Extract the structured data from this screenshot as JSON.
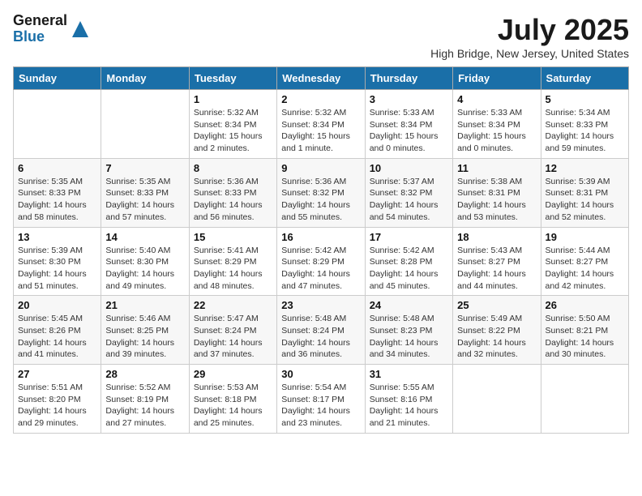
{
  "logo": {
    "general": "General",
    "blue": "Blue"
  },
  "title": "July 2025",
  "subtitle": "High Bridge, New Jersey, United States",
  "days_header": [
    "Sunday",
    "Monday",
    "Tuesday",
    "Wednesday",
    "Thursday",
    "Friday",
    "Saturday"
  ],
  "weeks": [
    [
      {
        "day": "",
        "info": ""
      },
      {
        "day": "",
        "info": ""
      },
      {
        "day": "1",
        "info": "Sunrise: 5:32 AM\nSunset: 8:34 PM\nDaylight: 15 hours and 2 minutes."
      },
      {
        "day": "2",
        "info": "Sunrise: 5:32 AM\nSunset: 8:34 PM\nDaylight: 15 hours and 1 minute."
      },
      {
        "day": "3",
        "info": "Sunrise: 5:33 AM\nSunset: 8:34 PM\nDaylight: 15 hours and 0 minutes."
      },
      {
        "day": "4",
        "info": "Sunrise: 5:33 AM\nSunset: 8:34 PM\nDaylight: 15 hours and 0 minutes."
      },
      {
        "day": "5",
        "info": "Sunrise: 5:34 AM\nSunset: 8:33 PM\nDaylight: 14 hours and 59 minutes."
      }
    ],
    [
      {
        "day": "6",
        "info": "Sunrise: 5:35 AM\nSunset: 8:33 PM\nDaylight: 14 hours and 58 minutes."
      },
      {
        "day": "7",
        "info": "Sunrise: 5:35 AM\nSunset: 8:33 PM\nDaylight: 14 hours and 57 minutes."
      },
      {
        "day": "8",
        "info": "Sunrise: 5:36 AM\nSunset: 8:33 PM\nDaylight: 14 hours and 56 minutes."
      },
      {
        "day": "9",
        "info": "Sunrise: 5:36 AM\nSunset: 8:32 PM\nDaylight: 14 hours and 55 minutes."
      },
      {
        "day": "10",
        "info": "Sunrise: 5:37 AM\nSunset: 8:32 PM\nDaylight: 14 hours and 54 minutes."
      },
      {
        "day": "11",
        "info": "Sunrise: 5:38 AM\nSunset: 8:31 PM\nDaylight: 14 hours and 53 minutes."
      },
      {
        "day": "12",
        "info": "Sunrise: 5:39 AM\nSunset: 8:31 PM\nDaylight: 14 hours and 52 minutes."
      }
    ],
    [
      {
        "day": "13",
        "info": "Sunrise: 5:39 AM\nSunset: 8:30 PM\nDaylight: 14 hours and 51 minutes."
      },
      {
        "day": "14",
        "info": "Sunrise: 5:40 AM\nSunset: 8:30 PM\nDaylight: 14 hours and 49 minutes."
      },
      {
        "day": "15",
        "info": "Sunrise: 5:41 AM\nSunset: 8:29 PM\nDaylight: 14 hours and 48 minutes."
      },
      {
        "day": "16",
        "info": "Sunrise: 5:42 AM\nSunset: 8:29 PM\nDaylight: 14 hours and 47 minutes."
      },
      {
        "day": "17",
        "info": "Sunrise: 5:42 AM\nSunset: 8:28 PM\nDaylight: 14 hours and 45 minutes."
      },
      {
        "day": "18",
        "info": "Sunrise: 5:43 AM\nSunset: 8:27 PM\nDaylight: 14 hours and 44 minutes."
      },
      {
        "day": "19",
        "info": "Sunrise: 5:44 AM\nSunset: 8:27 PM\nDaylight: 14 hours and 42 minutes."
      }
    ],
    [
      {
        "day": "20",
        "info": "Sunrise: 5:45 AM\nSunset: 8:26 PM\nDaylight: 14 hours and 41 minutes."
      },
      {
        "day": "21",
        "info": "Sunrise: 5:46 AM\nSunset: 8:25 PM\nDaylight: 14 hours and 39 minutes."
      },
      {
        "day": "22",
        "info": "Sunrise: 5:47 AM\nSunset: 8:24 PM\nDaylight: 14 hours and 37 minutes."
      },
      {
        "day": "23",
        "info": "Sunrise: 5:48 AM\nSunset: 8:24 PM\nDaylight: 14 hours and 36 minutes."
      },
      {
        "day": "24",
        "info": "Sunrise: 5:48 AM\nSunset: 8:23 PM\nDaylight: 14 hours and 34 minutes."
      },
      {
        "day": "25",
        "info": "Sunrise: 5:49 AM\nSunset: 8:22 PM\nDaylight: 14 hours and 32 minutes."
      },
      {
        "day": "26",
        "info": "Sunrise: 5:50 AM\nSunset: 8:21 PM\nDaylight: 14 hours and 30 minutes."
      }
    ],
    [
      {
        "day": "27",
        "info": "Sunrise: 5:51 AM\nSunset: 8:20 PM\nDaylight: 14 hours and 29 minutes."
      },
      {
        "day": "28",
        "info": "Sunrise: 5:52 AM\nSunset: 8:19 PM\nDaylight: 14 hours and 27 minutes."
      },
      {
        "day": "29",
        "info": "Sunrise: 5:53 AM\nSunset: 8:18 PM\nDaylight: 14 hours and 25 minutes."
      },
      {
        "day": "30",
        "info": "Sunrise: 5:54 AM\nSunset: 8:17 PM\nDaylight: 14 hours and 23 minutes."
      },
      {
        "day": "31",
        "info": "Sunrise: 5:55 AM\nSunset: 8:16 PM\nDaylight: 14 hours and 21 minutes."
      },
      {
        "day": "",
        "info": ""
      },
      {
        "day": "",
        "info": ""
      }
    ]
  ]
}
